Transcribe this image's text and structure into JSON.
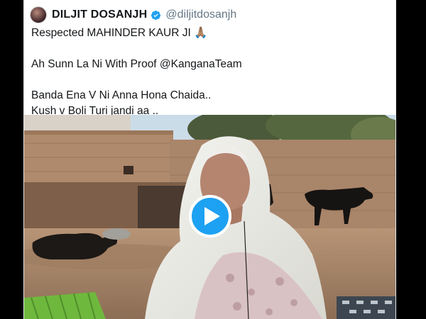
{
  "tweet": {
    "author_name": "DILJIT DOSANJH",
    "author_handle": "@diljitdosanjh",
    "lines": [
      "Respected MAHINDER KAUR JI 🙏🏽",
      "",
      "Ah Sunn La Ni With Proof @KanganaTeam",
      "",
      "Banda Ena V Ni Anna Hona Chaida..",
      "Kush v Boli Turi jandi aa .."
    ]
  },
  "icons": {
    "verified": "verified-badge-icon",
    "play": "play-icon"
  },
  "colors": {
    "accent": "#1da1f2",
    "background": "#000000"
  }
}
